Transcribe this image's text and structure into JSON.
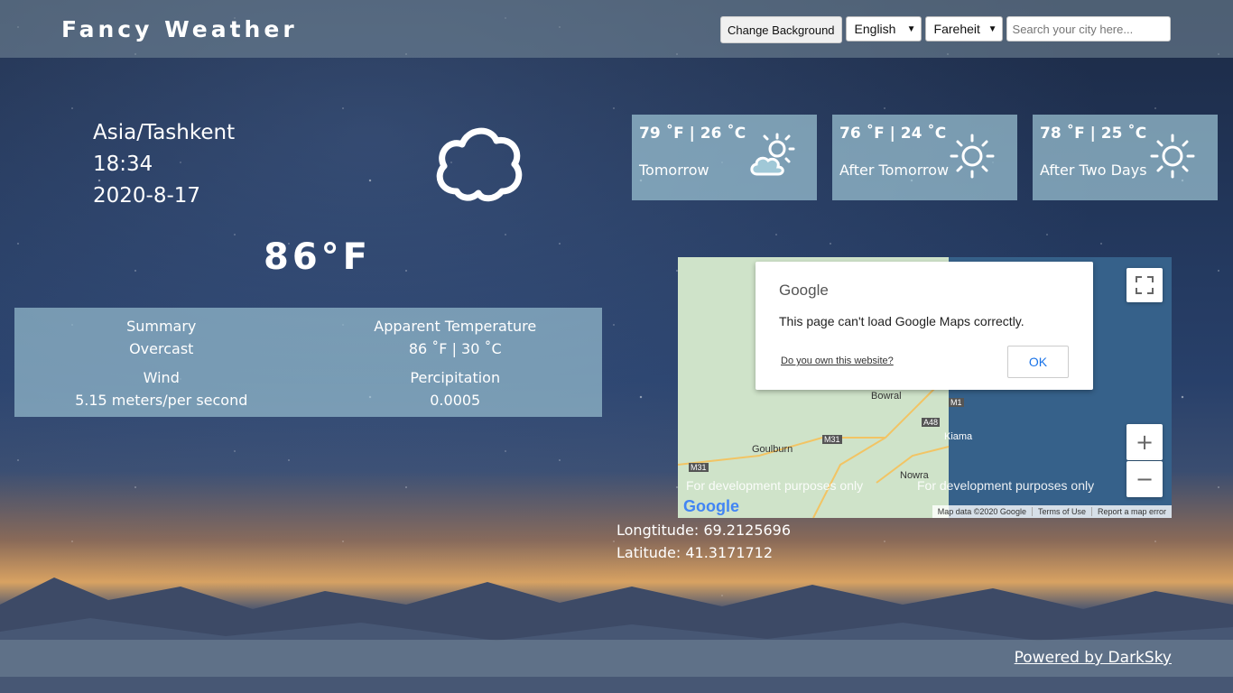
{
  "app": {
    "title": "Fancy Weather"
  },
  "header": {
    "change_background_label": "Change Background",
    "language_selected": "English",
    "units_selected": "Fareheit",
    "search_placeholder": "Search your city here..."
  },
  "location": {
    "timezone": "Asia/Tashkent",
    "time": "18:34",
    "date": "2020-8-17"
  },
  "current": {
    "icon": "cloud-icon",
    "temperature": "86°F"
  },
  "details": {
    "summary_label": "Summary",
    "summary_value": "Overcast",
    "apparent_label": "Apparent Temperature",
    "apparent_value": "86 ˚F | 30 ˚C",
    "wind_label": "Wind",
    "wind_value": "5.15 meters/per second",
    "precip_label": "Percipitation",
    "precip_value": "0.0005"
  },
  "forecast": [
    {
      "temp": "79 ˚F | 26 ˚C",
      "day": "Tomorrow",
      "icon": "partly-cloudy-icon"
    },
    {
      "temp": "76 ˚F | 24 ˚C",
      "day": "After Tomorrow",
      "icon": "sun-icon"
    },
    {
      "temp": "78 ˚F | 25 ˚C",
      "day": "After Two Days",
      "icon": "sun-icon"
    }
  ],
  "map": {
    "dialog_brand": "Google",
    "dialog_message": "This page can't load Google Maps correctly.",
    "dialog_link": "Do you own this website?",
    "dialog_ok": "OK",
    "dev_text": "For development purposes only",
    "places": [
      "Bowral",
      "Goulburn",
      "Kiama",
      "Nowra",
      "M1",
      "A48",
      "M31",
      "M31"
    ],
    "logo": "Google",
    "attribution": [
      "Map data ©2020 Google",
      "Terms of Use",
      "Report a map error"
    ],
    "zoom_in": "+",
    "zoom_out": "−"
  },
  "coords": {
    "longitude": "Longtitude: 69.2125696",
    "latitude": "Latitude: 41.3171712"
  },
  "footer": {
    "powered_by": "Powered by DarkSky"
  }
}
